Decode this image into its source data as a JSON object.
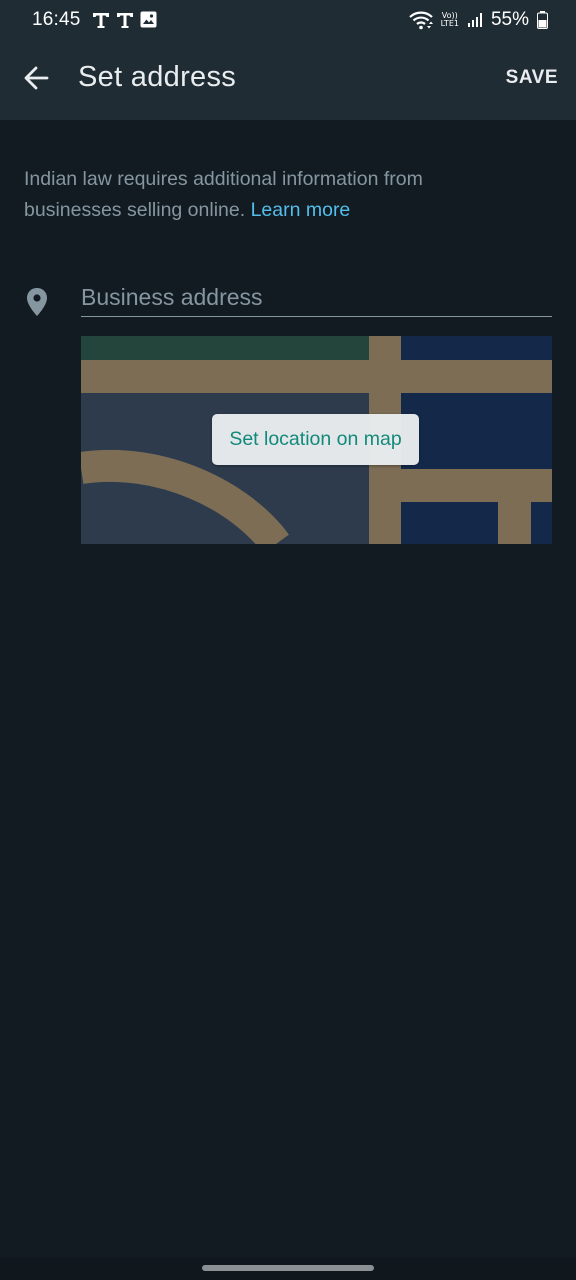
{
  "status_bar": {
    "time": "16:45",
    "battery": "55%",
    "network_label_top": "Vo))",
    "network_label_bottom": "LTE1",
    "icons": [
      "t-icon",
      "t-icon",
      "image-icon",
      "wifi-icon",
      "signal-icon",
      "battery-icon"
    ]
  },
  "toolbar": {
    "title": "Set address",
    "save_label": "SAVE",
    "back_icon": "arrow-left-icon"
  },
  "notice": {
    "text": "Indian law requires additional information from businesses selling online.",
    "link_text": "Learn more"
  },
  "address": {
    "placeholder": "Business address",
    "value": "",
    "icon": "location-pin-icon"
  },
  "map": {
    "button_label": "Set location on map",
    "colors": {
      "land": "#2d3b4d",
      "road": "#7d6d55",
      "park": "#24453b",
      "water": "#14294a"
    }
  },
  "colors": {
    "background": "#121b22",
    "header": "#202c33",
    "accent_link": "#53bdeb",
    "map_button_text": "#128c7e"
  }
}
